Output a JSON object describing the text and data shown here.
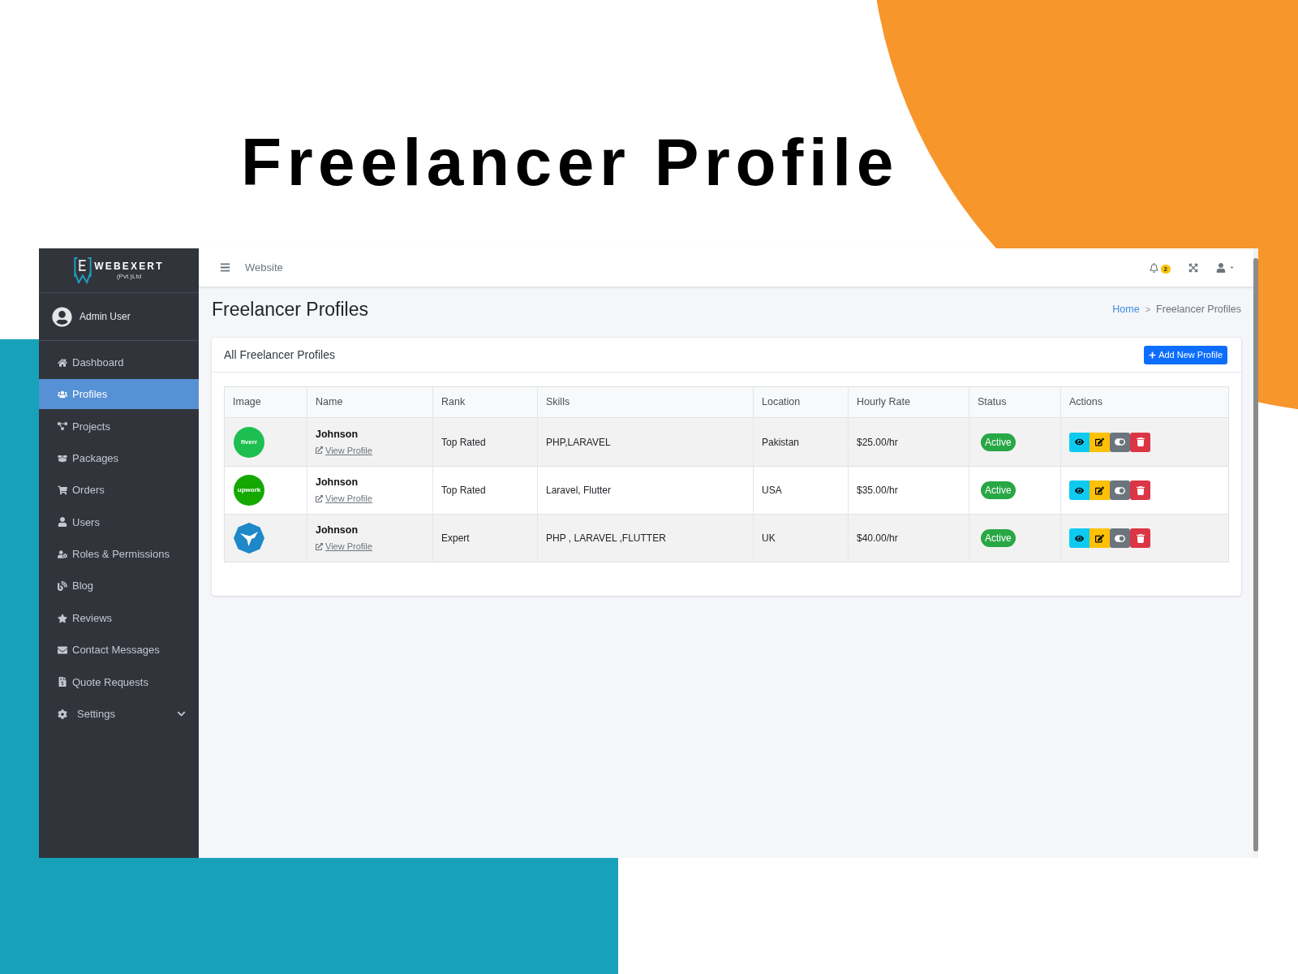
{
  "slide": {
    "title": "Freelancer Profile"
  },
  "sidebar": {
    "brand": {
      "name": "WEBEXERT",
      "tagline": "(Pvt.)Ltd"
    },
    "user": {
      "name": "Admin User"
    },
    "items": [
      {
        "label": "Dashboard",
        "kind": "link",
        "selected": false
      },
      {
        "label": "Profiles",
        "kind": "link",
        "selected": true
      },
      {
        "label": "Projects",
        "kind": "link",
        "selected": false
      },
      {
        "label": "Packages",
        "kind": "link",
        "selected": false
      },
      {
        "label": "Orders",
        "kind": "link",
        "selected": false
      },
      {
        "label": "Users",
        "kind": "link",
        "selected": false
      },
      {
        "label": "Roles & Permissions",
        "kind": "link",
        "selected": false
      },
      {
        "label": "Blog",
        "kind": "link",
        "selected": false
      },
      {
        "label": "Reviews",
        "kind": "link",
        "selected": false
      },
      {
        "label": "Contact Messages",
        "kind": "link",
        "selected": false
      },
      {
        "label": "Quote Requests",
        "kind": "link",
        "selected": false
      },
      {
        "label": "Settings",
        "kind": "group",
        "selected": false,
        "expanded": false
      }
    ]
  },
  "topbar": {
    "nav_link": "Website",
    "notification_count": "2"
  },
  "header": {
    "title": "Freelancer Profiles",
    "breadcrumb": {
      "separator": ">",
      "items": [
        {
          "label": "Home",
          "kind": "link"
        },
        {
          "label": "Freelancer Profiles",
          "kind": "current"
        }
      ]
    }
  },
  "card": {
    "title": "All Freelancer Profiles",
    "add_button": "Add New Profile",
    "table": {
      "columns": [
        "Image",
        "Name",
        "Rank",
        "Skills",
        "Location",
        "Hourly Rate",
        "Status",
        "Actions"
      ],
      "rows": [
        {
          "logo": {
            "kind": "text",
            "text": "fiverr",
            "color": "#1dbf50"
          },
          "name": "Johnson",
          "profile_link": "View Profile",
          "rank": "Top Rated",
          "skills": "PHP,LARAVEL",
          "location": "Pakistan",
          "hourly_rate": "$25.00/hr",
          "status": "Active"
        },
        {
          "logo": {
            "kind": "text",
            "text": "upwork",
            "color": "#14a800"
          },
          "name": "Johnson",
          "profile_link": "View Profile",
          "rank": "Top Rated",
          "skills": "Laravel, Flutter",
          "location": "USA",
          "hourly_rate": "$35.00/hr",
          "status": "Active"
        },
        {
          "logo": {
            "kind": "symbol",
            "color": "#1e88c9"
          },
          "name": "Johnson",
          "profile_link": "View Profile",
          "rank": "Expert",
          "skills": "PHP , LARAVEL ,FLUTTER",
          "location": "UK",
          "hourly_rate": "$40.00/hr",
          "status": "Active"
        }
      ]
    }
  }
}
